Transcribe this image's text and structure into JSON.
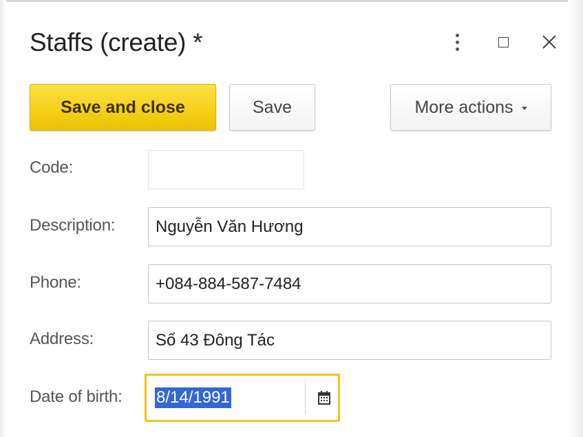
{
  "window": {
    "title": "Staffs (create) *"
  },
  "toolbar": {
    "save_and_close_label": "Save and close",
    "save_label": "Save",
    "more_actions_label": "More actions"
  },
  "form": {
    "code": {
      "label": "Code:",
      "value": ""
    },
    "description": {
      "label": "Description:",
      "value": "Nguyễn Văn Hương"
    },
    "phone": {
      "label": "Phone:",
      "value": "+084-884-587-7484"
    },
    "address": {
      "label": "Address:",
      "value": "Số 43 Đông Tác"
    },
    "date_of_birth": {
      "label": "Date of birth:",
      "value": "8/14/1991"
    }
  },
  "icons": {
    "menu": "more-vertical-icon",
    "maximize": "maximize-icon",
    "close": "close-icon",
    "calendar": "calendar-icon",
    "dropdown": "caret-down-icon"
  },
  "colors": {
    "primary_button": "#f4cf13",
    "focus_border": "#f2c318",
    "selection": "#3367d6"
  }
}
